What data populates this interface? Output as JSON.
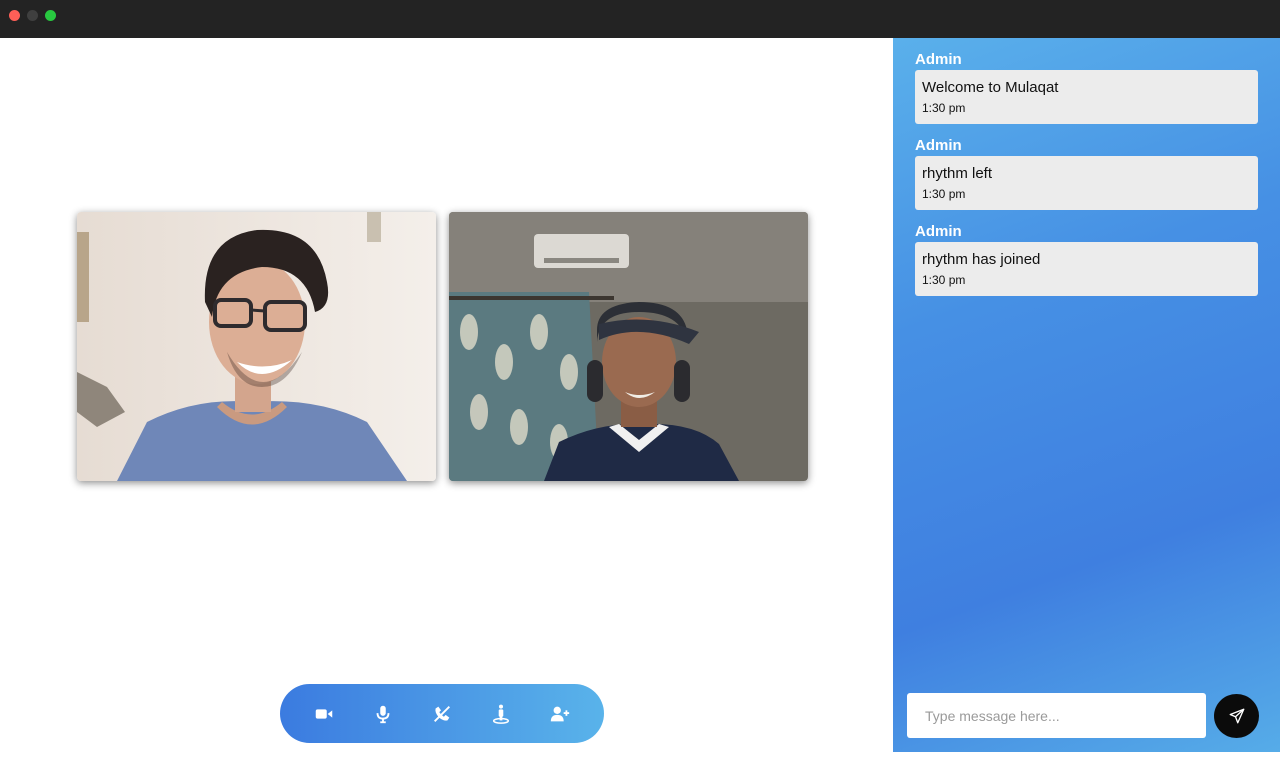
{
  "window": {
    "controls": [
      "close",
      "minimize",
      "maximize"
    ]
  },
  "videos": [
    {
      "participant_icon": "person-glasses-video-feed"
    },
    {
      "participant_icon": "person-headphones-video-feed"
    }
  ],
  "controls": [
    {
      "name": "video-camera-button",
      "icon": "video-camera-icon"
    },
    {
      "name": "microphone-button",
      "icon": "microphone-icon"
    },
    {
      "name": "end-call-button",
      "icon": "phone-hangup-icon"
    },
    {
      "name": "participants-button",
      "icon": "person-stand-icon"
    },
    {
      "name": "add-user-button",
      "icon": "user-plus-icon"
    }
  ],
  "chat": {
    "messages": [
      {
        "author": "Admin",
        "text": "Welcome to Mulaqat",
        "time": "1:30 pm"
      },
      {
        "author": "Admin",
        "text": "rhythm left",
        "time": "1:30 pm"
      },
      {
        "author": "Admin",
        "text": "rhythm has joined",
        "time": "1:30 pm"
      }
    ],
    "input": {
      "placeholder": "Type message here...",
      "value": ""
    },
    "send_icon": "paper-plane-icon"
  },
  "colors": {
    "titlebar": "#232323",
    "close": "#fe5f57",
    "minimize": "#3f3f3f",
    "maximize": "#28c840",
    "accent_start": "#3b7be0",
    "accent_end": "#59b3ea",
    "bubble": "#ececec",
    "send_button": "#0b0b0b"
  }
}
